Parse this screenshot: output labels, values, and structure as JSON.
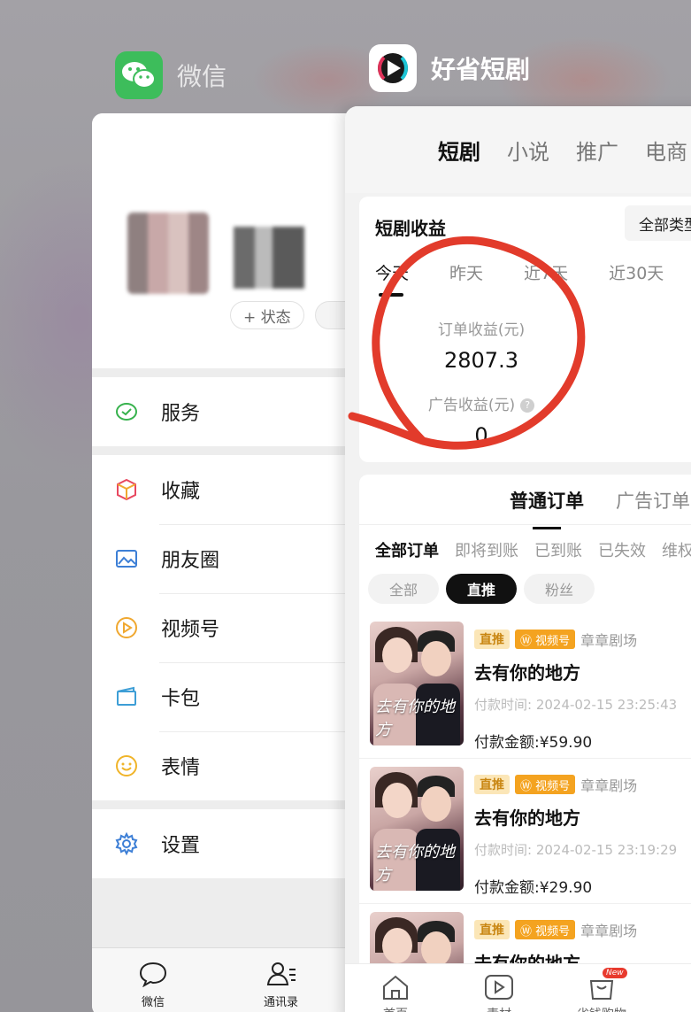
{
  "wechat": {
    "app_name": "微信",
    "status_label": "+ 状态",
    "menu": [
      {
        "label": "服务",
        "icon": "service-icon"
      },
      {
        "label": "收藏",
        "icon": "favorites-icon"
      },
      {
        "label": "朋友圈",
        "icon": "moments-icon"
      },
      {
        "label": "视频号",
        "icon": "channels-icon"
      },
      {
        "label": "卡包",
        "icon": "card-wallet-icon"
      },
      {
        "label": "表情",
        "icon": "sticker-icon"
      },
      {
        "label": "设置",
        "icon": "settings-icon"
      }
    ],
    "tabbar": {
      "chats": "微信",
      "contacts": "通讯录"
    }
  },
  "drama": {
    "app_name": "好省短剧",
    "top_tabs": [
      "短剧",
      "小说",
      "推广",
      "电商"
    ],
    "earnings": {
      "title": "短剧收益",
      "type_select": "全部类型",
      "periods": [
        "今天",
        "昨天",
        "近7天",
        "近30天"
      ],
      "order_label": "订单收益(元)",
      "order_value": "2807.3",
      "ad_label": "广告收益(元)",
      "ad_value": "0"
    },
    "order_types": [
      "普通订单",
      "广告订单"
    ],
    "status_tabs": [
      "全部订单",
      "即将到账",
      "已到账",
      "已失效",
      "维权"
    ],
    "chips": [
      "全部",
      "直推",
      "粉丝"
    ],
    "orders": [
      {
        "tag": "直推",
        "channel": "视频号",
        "theater": "章章剧场",
        "title": "去有你的地方",
        "time_label": "付款时间:",
        "time": "2024-02-15 23:25:43",
        "amount_label": "付款金额:",
        "amount": "¥59.90",
        "poster_title": "去有你的地方"
      },
      {
        "tag": "直推",
        "channel": "视频号",
        "theater": "章章剧场",
        "title": "去有你的地方",
        "time_label": "付款时间:",
        "time": "2024-02-15 23:19:29",
        "amount_label": "付款金额:",
        "amount": "¥29.90",
        "poster_title": "去有你的地方"
      },
      {
        "tag": "直推",
        "channel": "视频号",
        "theater": "章章剧场",
        "title": "去有你的地方",
        "poster_title": ""
      }
    ],
    "tabbar": {
      "home": "首页",
      "material": "素材",
      "shop": "省钱购物",
      "new_badge": "New"
    }
  },
  "colors": {
    "annotation_red": "#e23b2b",
    "wechat_green": "#3dbd5b",
    "tag_orange": "#f4a320"
  }
}
